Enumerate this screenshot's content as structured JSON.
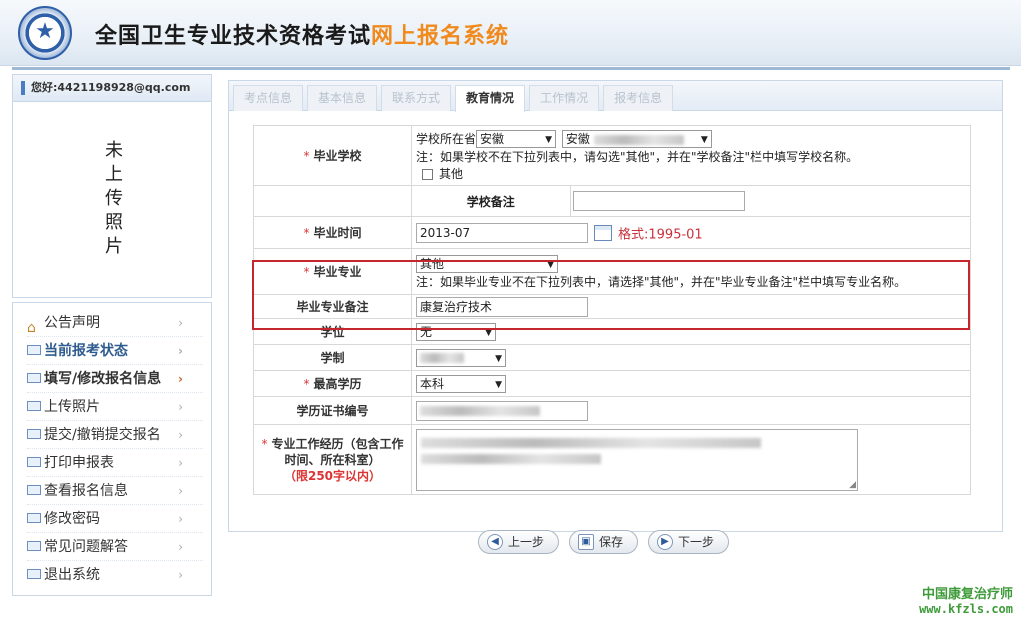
{
  "header": {
    "title_main": "全国卫生专业技术资格考试",
    "title_highlight": "网上报名系统"
  },
  "user": {
    "greeting": "您好:4421198928@qq.com"
  },
  "photo": {
    "placeholder": "未上传照片"
  },
  "menu": {
    "items": [
      {
        "label": "公告声明"
      },
      {
        "label": "当前报考状态"
      },
      {
        "label": "填写/修改报名信息"
      },
      {
        "label": "上传照片"
      },
      {
        "label": "提交/撤销提交报名"
      },
      {
        "label": "打印申报表"
      },
      {
        "label": "查看报名信息"
      },
      {
        "label": "修改密码"
      },
      {
        "label": "常见问题解答"
      },
      {
        "label": "退出系统"
      }
    ]
  },
  "tabs": [
    {
      "label": "考点信息"
    },
    {
      "label": "基本信息"
    },
    {
      "label": "联系方式"
    },
    {
      "label": "教育情况"
    },
    {
      "label": "工作情况"
    },
    {
      "label": "报考信息"
    }
  ],
  "form": {
    "school": {
      "label": "毕业学校",
      "province_prefix": "学校所在省",
      "province_value": "安徽",
      "school_value": "安徽",
      "note": "注：如果学校不在下拉列表中，请勾选\"其他\"，并在\"学校备注\"栏中填写学校名称。",
      "other_label": "其他"
    },
    "school_note": {
      "label": "学校备注",
      "value": ""
    },
    "grad_time": {
      "label": "毕业时间",
      "value": "2013-07",
      "format_hint": "格式:1995-01"
    },
    "major": {
      "label": "毕业专业",
      "value": "其他",
      "note": "注：如果毕业专业不在下拉列表中，请选择\"其他\"，并在\"毕业专业备注\"栏中填写专业名称。"
    },
    "major_note": {
      "label": "毕业专业备注",
      "value": "康复治疗技术"
    },
    "degree": {
      "label": "学位",
      "value": "无"
    },
    "schooling": {
      "label": "学制",
      "value": ""
    },
    "education": {
      "label": "最高学历",
      "value": "本科"
    },
    "cert_no": {
      "label": "学历证书编号",
      "value": ""
    },
    "experience": {
      "label_line1": "专业工作经历（包含工作",
      "label_line2": "时间、所在科室）",
      "limit": "（限250字以内）",
      "value": ""
    }
  },
  "buttons": {
    "prev": "上一步",
    "save": "保存",
    "next": "下一步"
  },
  "watermark": {
    "line1": "中国康复治疗师",
    "line2": "www.kfzls.com"
  }
}
